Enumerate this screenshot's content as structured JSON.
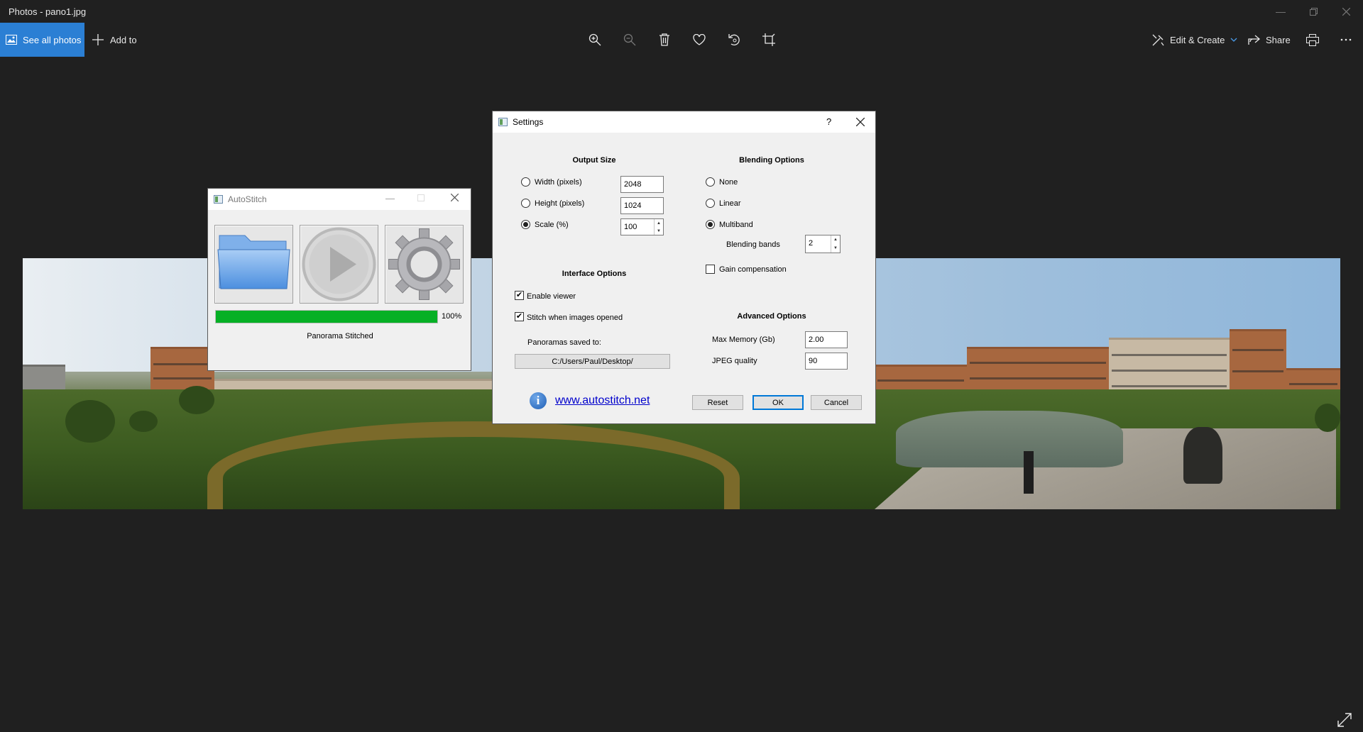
{
  "app": {
    "window_title": "Photos - pano1.jpg",
    "see_all_label": "See all photos",
    "add_to_label": "Add to",
    "edit_create_label": "Edit & Create",
    "share_label": "Share"
  },
  "autostitch": {
    "title": "AutoStitch",
    "progress_label": "100%",
    "progress_value": 1.0,
    "status": "Panorama Stitched"
  },
  "settings": {
    "title": "Settings",
    "help_label": "?",
    "output_size": {
      "heading": "Output Size",
      "width_label": "Width (pixels)",
      "width_value": "2048",
      "height_label": "Height (pixels)",
      "height_value": "1024",
      "scale_label": "Scale (%)",
      "scale_value": "100",
      "selected": "scale"
    },
    "blending": {
      "heading": "Blending Options",
      "none_label": "None",
      "linear_label": "Linear",
      "multiband_label": "Multiband",
      "selected": "multiband",
      "bands_label": "Blending bands",
      "bands_value": "2",
      "gain_label": "Gain compensation",
      "gain_checked": false
    },
    "interface": {
      "heading": "Interface Options",
      "viewer_label": "Enable viewer",
      "viewer_checked": true,
      "stitch_label": "Stitch when images opened",
      "stitch_checked": true,
      "saved_to_label": "Panoramas saved to:",
      "saved_to_path": "C:/Users/Paul/Desktop/"
    },
    "advanced": {
      "heading": "Advanced Options",
      "memory_label": "Max Memory (Gb)",
      "memory_value": "2.00",
      "jpeg_label": "JPEG quality",
      "jpeg_value": "90"
    },
    "link_text": "www.autostitch.net",
    "reset_label": "Reset",
    "ok_label": "OK",
    "cancel_label": "Cancel"
  },
  "colors": {
    "background": "#202020",
    "accent": "#2b7fd4",
    "progress": "#06b025",
    "link": "#0000cc"
  },
  "icons": [
    "zoom-in-icon",
    "zoom-out-icon",
    "delete-icon",
    "heart-icon",
    "rotate-icon",
    "crop-icon",
    "print-icon",
    "more-icon",
    "expand-icon",
    "folder-icon",
    "play-icon",
    "gear-icon",
    "info-icon"
  ]
}
